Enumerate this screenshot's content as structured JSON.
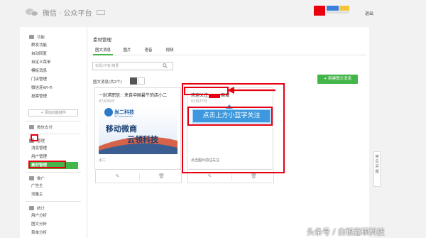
{
  "topbar": {
    "logo_text": "微信 · 公众平台",
    "logo_badge": "",
    "account_name": "",
    "account_tag": "",
    "logout": "退出"
  },
  "sidebar": {
    "sections": [
      {
        "title": "功能",
        "items": [
          "群发功能",
          "自动回复",
          "自定义菜单",
          "模板消息",
          "门店管理",
          "微信连Wi-Fi",
          "投票管理"
        ]
      },
      {
        "title": "微信支付",
        "items": []
      },
      {
        "title": "管理",
        "items": [
          "消息管理",
          "用户管理",
          "素材管理"
        ]
      },
      {
        "title": "推广",
        "items": [
          "广告主",
          "流量主"
        ]
      },
      {
        "title": "统计",
        "items": [
          "用户分析",
          "图文分析",
          "菜单分析"
        ]
      }
    ],
    "add_plugin": "+ 添加功能插件",
    "active_item": "素材管理"
  },
  "main": {
    "title": "素材管理",
    "tabs": [
      "图文消息",
      "图片",
      "语音",
      "视频"
    ],
    "active_tab": "图文消息",
    "search_placeholder": "标题/作者/摘要",
    "list_label": "图文消息(共2个)",
    "new_button": "+ 新建图文消息",
    "cards": [
      {
        "title": "一封求职信：来自中国最牛的店小二",
        "date": "07月30日",
        "image": {
          "brand": "尚二科技",
          "brand_en": "SZ Information",
          "line1": "移动微商",
          "line2": "云领科技"
        },
        "desc": "小二"
      },
      {
        "title": "欢迎关注",
        "title_suffix": "商城",
        "date": "03月27日",
        "banner_text": "点击上方小蓝字关注",
        "desc": "点击图片前往关注"
      }
    ]
  },
  "float_help": "常见问题",
  "watermark": "头条号 / 白银嘉硕科技",
  "colors": {
    "accent": "#44b549",
    "annotation": "#e60012",
    "banner": "#3d98dd"
  },
  "icons": [
    "search-icon",
    "edit-icon",
    "delete-icon",
    "grid-view-icon",
    "list-view-icon"
  ]
}
